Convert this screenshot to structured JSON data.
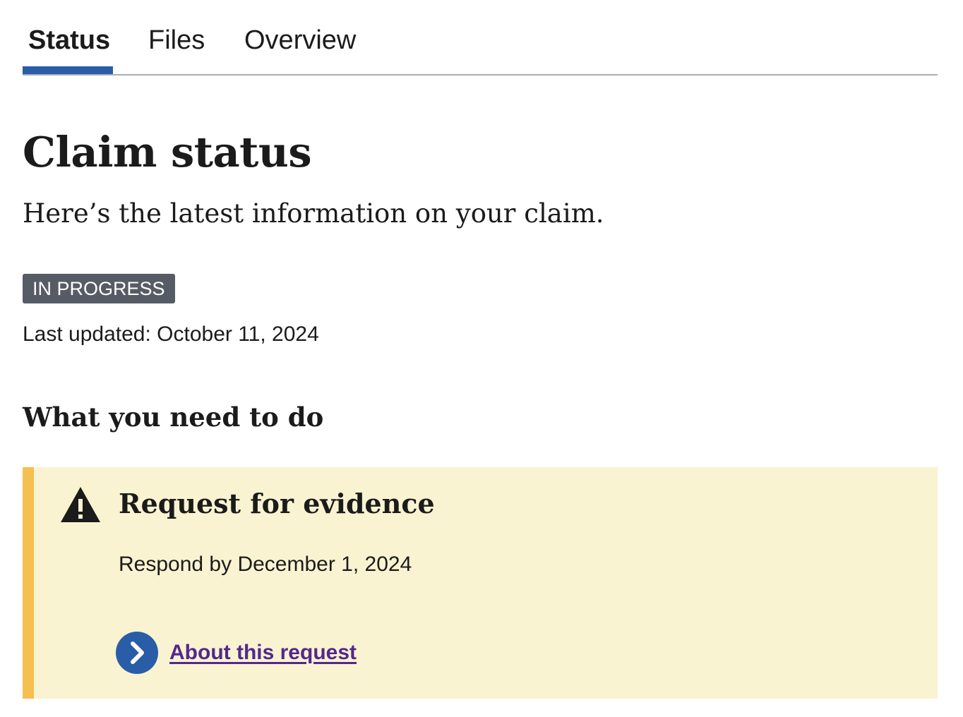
{
  "tabs": [
    {
      "label": "Status",
      "active": true
    },
    {
      "label": "Files",
      "active": false
    },
    {
      "label": "Overview",
      "active": false
    }
  ],
  "page": {
    "title": "Claim status",
    "subtitle": "Here’s the latest information on your claim."
  },
  "status": {
    "badge": "IN PROGRESS",
    "last_updated": "Last updated: October 11, 2024"
  },
  "section": {
    "heading": "What you need to do"
  },
  "alert": {
    "icon": "warning-icon",
    "title": "Request for evidence",
    "body": "Respond by December 1, 2024",
    "link_icon": "chevron-right-circle-icon",
    "link_label": "About this request"
  },
  "colors": {
    "tab_indicator": "#2a5da8",
    "badge_background": "#565c65",
    "alert_background": "#faf3d1",
    "alert_border": "#f5c04f",
    "action_icon": "#2a5da8",
    "link": "#54278f"
  }
}
